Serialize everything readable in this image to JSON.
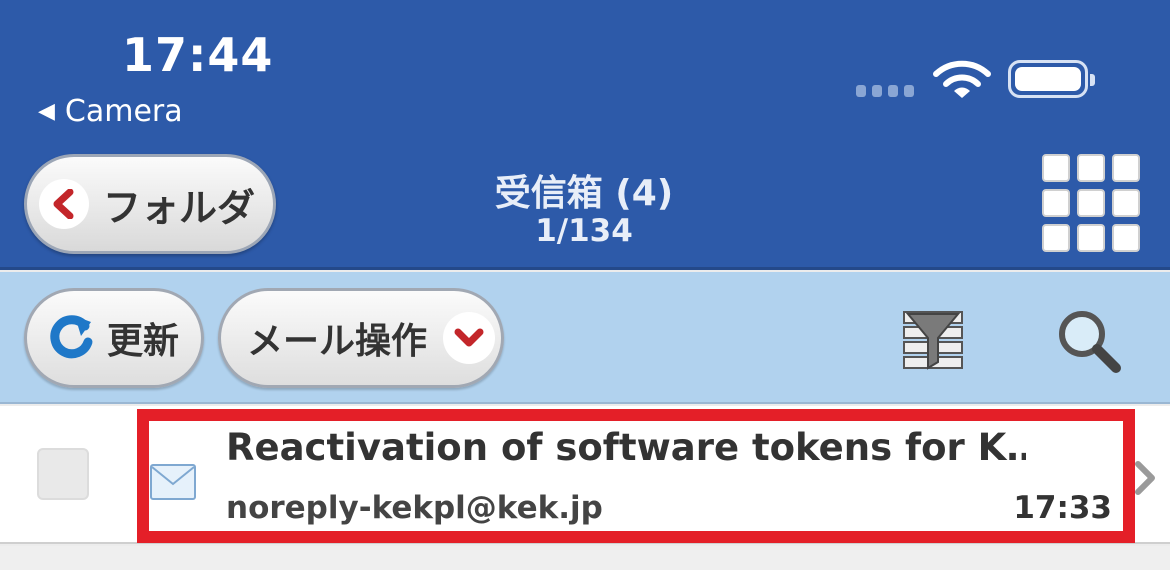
{
  "status_bar": {
    "time": "17:44",
    "back_label": "Camera",
    "back_arrow": "◀"
  },
  "nav": {
    "folder_button_label": "フォルダ",
    "title": "受信箱 (4)",
    "page_count": "1/134",
    "menu_icon": "grid-menu-icon"
  },
  "toolbar": {
    "refresh_label": "更新",
    "mail_ops_label": "メール操作",
    "filter_icon": "filter-icon",
    "search_icon": "search-icon"
  },
  "mail_list": [
    {
      "subject": "Reactivation of software tokens for K…",
      "sender": "noreply-kekpl@kek.jp",
      "time": "17:33",
      "unread": true
    }
  ],
  "colors": {
    "header_blue": "#2d5aa9",
    "toolbar_blue": "#b1d2ee",
    "highlight_red": "#e41f28"
  }
}
